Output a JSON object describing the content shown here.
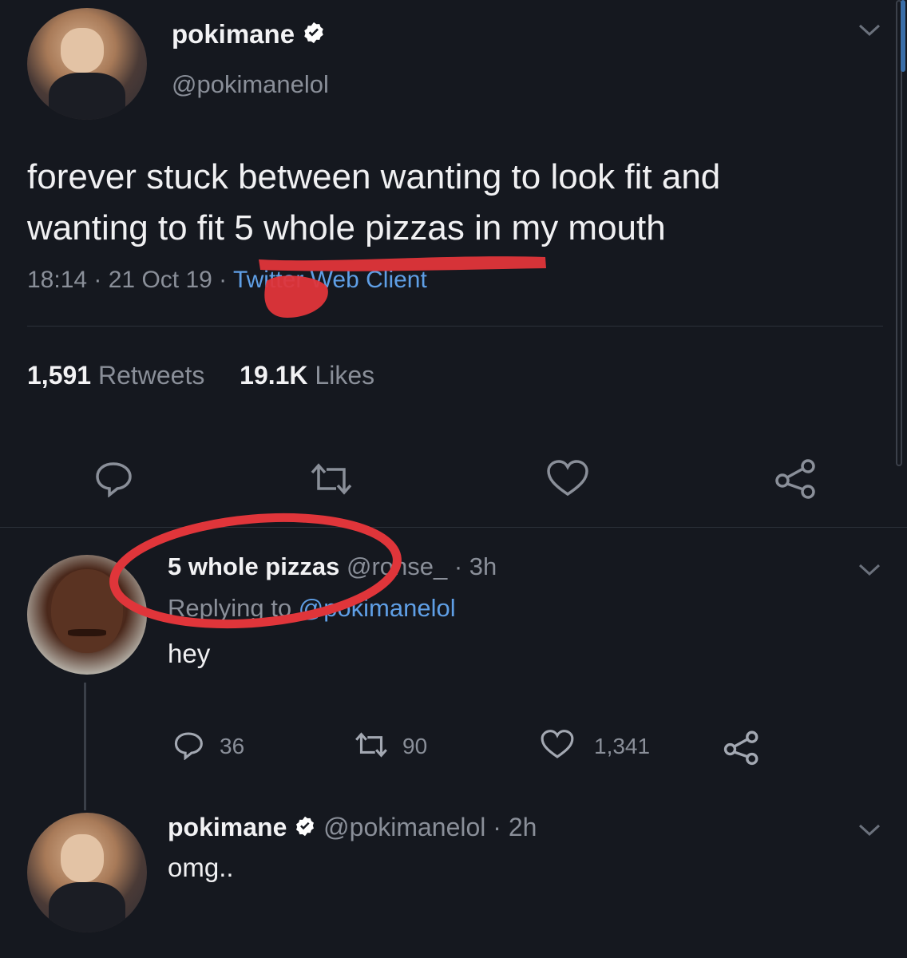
{
  "tweet": {
    "author_name": "pokimane",
    "handle": "@pokimanelol",
    "text_line1": "forever stuck between wanting to look fit and",
    "text_line2": "wanting to fit 5 whole pizzas in my mouth",
    "time": "18:14",
    "date": "21 Oct 19",
    "client": "Twitter Web Client",
    "retweets_count": "1,591",
    "retweets_label": "Retweets",
    "likes_count": "19.1K",
    "likes_label": "Likes"
  },
  "reply": {
    "author_name": "5 whole pizzas",
    "handle": "@ronse_",
    "time": "3h",
    "replying_label": "Replying to",
    "replying_handle": "@pokimanelol",
    "text": "hey",
    "reply_count": "36",
    "retweet_count": "90",
    "like_count": "1,341"
  },
  "reply2": {
    "author_name": "pokimane",
    "handle": "@pokimanelol",
    "time": "2h",
    "text": "omg.."
  },
  "colors": {
    "background": "#15181f",
    "link": "#5f9fe6",
    "annotation": "#e0353a",
    "verified": "#ffffff"
  },
  "icons": [
    "chevron-down-icon",
    "verified-badge-icon",
    "reply-icon",
    "retweet-icon",
    "heart-icon",
    "share-icon"
  ]
}
